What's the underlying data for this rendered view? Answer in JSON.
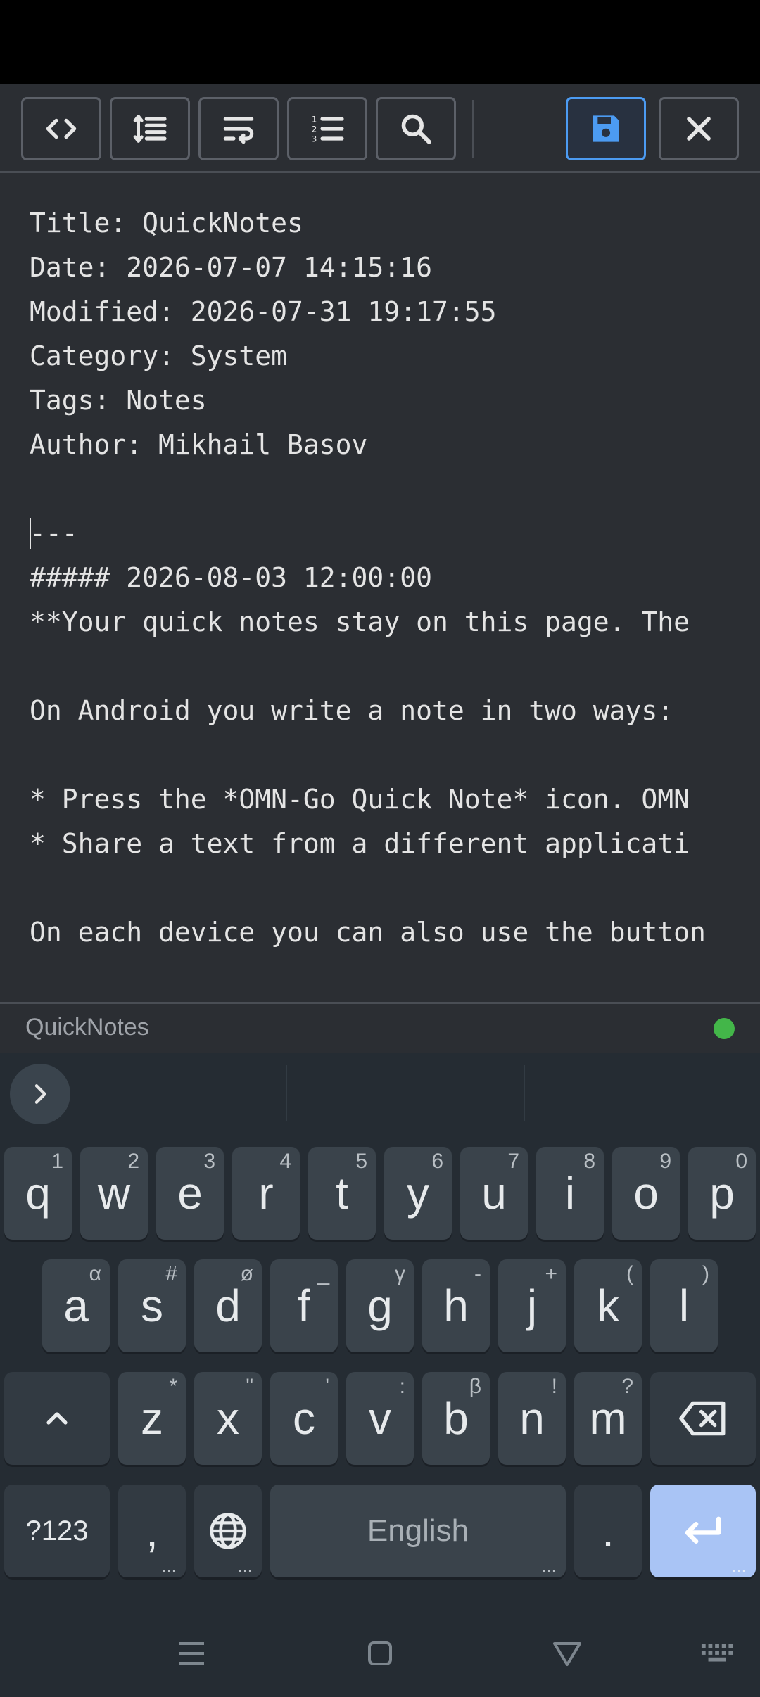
{
  "toolbar": {
    "buttons": [
      {
        "icon": "code-icon"
      },
      {
        "icon": "line-height-icon"
      },
      {
        "icon": "wrap-text-icon"
      },
      {
        "icon": "numbered-list-icon"
      },
      {
        "icon": "search-icon"
      },
      {
        "icon": "save-icon"
      },
      {
        "icon": "close-icon"
      }
    ],
    "accent": "#4c9bf2"
  },
  "editor": {
    "lines": [
      "Title: QuickNotes",
      "Date: 2026-07-07 14:15:16",
      "Modified: 2026-07-31 19:17:55",
      "Category: System",
      "Tags: Notes",
      "Author: Mikhail Basov",
      "",
      "---",
      "##### 2026-08-03 12:00:00",
      "**Your quick notes stay on this page. The",
      "",
      "On Android you write a note in two ways:",
      "",
      "* Press the *OMN-Go Quick Note* icon. OMN",
      "* Share a text from a different applicati",
      "",
      "On each device you can also use the button"
    ]
  },
  "footer": {
    "title": "QuickNotes",
    "status_color": "#43b649"
  },
  "keyboard": {
    "row1": [
      {
        "k": "q",
        "h": "1"
      },
      {
        "k": "w",
        "h": "2"
      },
      {
        "k": "e",
        "h": "3"
      },
      {
        "k": "r",
        "h": "4"
      },
      {
        "k": "t",
        "h": "5"
      },
      {
        "k": "y",
        "h": "6"
      },
      {
        "k": "u",
        "h": "7"
      },
      {
        "k": "i",
        "h": "8"
      },
      {
        "k": "o",
        "h": "9"
      },
      {
        "k": "p",
        "h": "0"
      }
    ],
    "row2": [
      {
        "k": "a",
        "h": "α"
      },
      {
        "k": "s",
        "h": "#"
      },
      {
        "k": "d",
        "h": "ø"
      },
      {
        "k": "f",
        "h": "_"
      },
      {
        "k": "g",
        "h": "γ"
      },
      {
        "k": "h",
        "h": "-"
      },
      {
        "k": "j",
        "h": "+"
      },
      {
        "k": "k",
        "h": "("
      },
      {
        "k": "l",
        "h": ")"
      }
    ],
    "row3": [
      {
        "k": "z",
        "h": "*"
      },
      {
        "k": "x",
        "h": "\""
      },
      {
        "k": "c",
        "h": "'"
      },
      {
        "k": "v",
        "h": ":"
      },
      {
        "k": "b",
        "h": "β"
      },
      {
        "k": "n",
        "h": "!"
      },
      {
        "k": "m",
        "h": "?"
      }
    ],
    "symbols_label": "?123",
    "comma": ",",
    "space_label": "English",
    "period": ".",
    "more_dots": "…"
  }
}
